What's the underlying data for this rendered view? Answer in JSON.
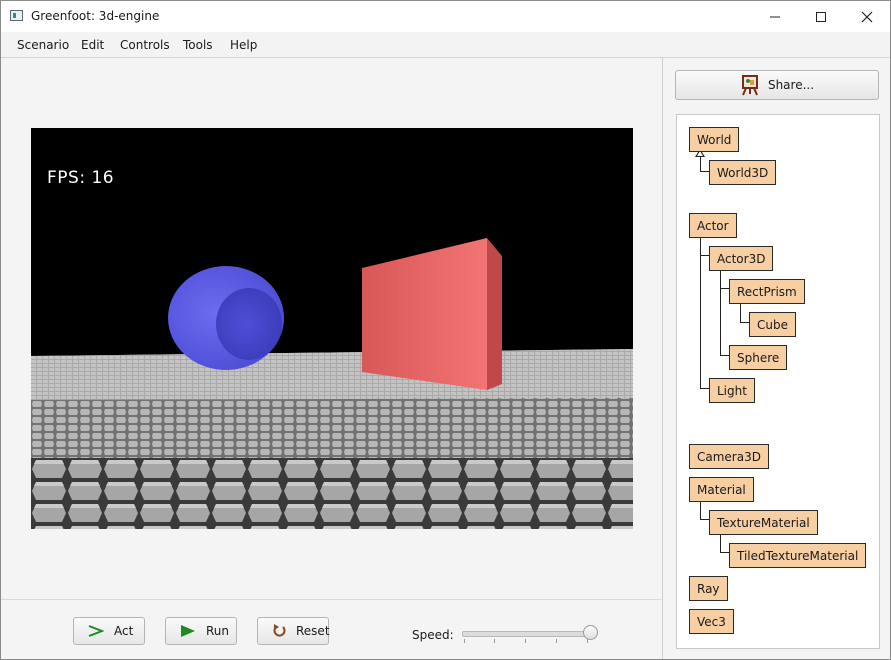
{
  "window": {
    "title": "Greenfoot: 3d-engine"
  },
  "menu": [
    "Scenario",
    "Edit",
    "Controls",
    "Tools",
    "Help"
  ],
  "world": {
    "fps_label": "FPS: 16"
  },
  "controls": {
    "act": "Act",
    "run": "Run",
    "reset": "Reset",
    "speed_label": "Speed:"
  },
  "speed": {
    "value_fraction": 1.0
  },
  "share": {
    "label": "Share..."
  },
  "classes": {
    "world": "World",
    "world3d": "World3D",
    "actor": "Actor",
    "actor3d": "Actor3D",
    "rectprism": "RectPrism",
    "cube": "Cube",
    "sphere": "Sphere",
    "light": "Light",
    "camera3d": "Camera3D",
    "material": "Material",
    "texturematerial": "TextureMaterial",
    "tiledtexturematerial": "TiledTextureMaterial",
    "ray": "Ray",
    "vec3": "Vec3"
  },
  "colors": {
    "class_box": "#f7cfa3",
    "sphere": "#5a5ce0",
    "box": "#f06868",
    "accent_green": "#1f8a1f"
  }
}
